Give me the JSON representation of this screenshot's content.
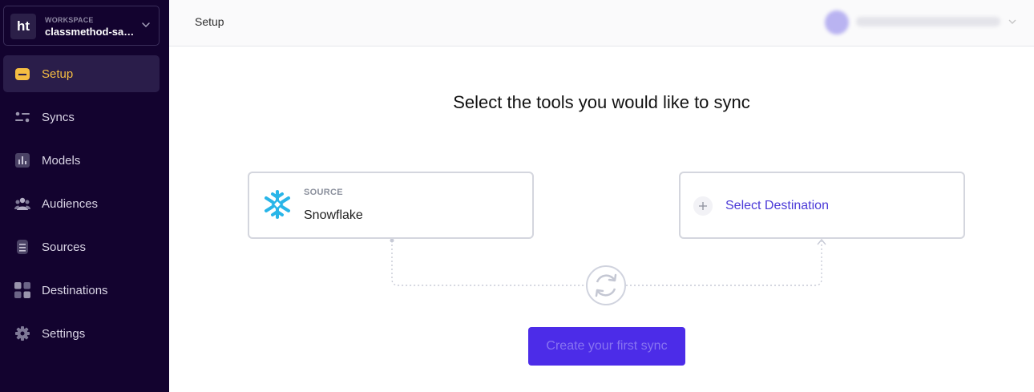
{
  "workspace": {
    "logo_text": "ht",
    "label": "WORKSPACE",
    "name": "classmethod-sag…"
  },
  "sidebar": {
    "items": [
      {
        "label": "Setup",
        "icon": "folder-icon",
        "active": true
      },
      {
        "label": "Syncs",
        "icon": "syncs-icon",
        "active": false
      },
      {
        "label": "Models",
        "icon": "bar-chart-icon",
        "active": false
      },
      {
        "label": "Audiences",
        "icon": "users-icon",
        "active": false
      },
      {
        "label": "Sources",
        "icon": "database-icon",
        "active": false
      },
      {
        "label": "Destinations",
        "icon": "grid-icon",
        "active": false
      },
      {
        "label": "Settings",
        "icon": "gear-icon",
        "active": false
      }
    ]
  },
  "header": {
    "breadcrumb": "Setup"
  },
  "main": {
    "heading": "Select the tools you would like to sync",
    "source": {
      "label": "SOURCE",
      "name": "Snowflake"
    },
    "destination": {
      "label": "Select Destination"
    },
    "cta_label": "Create your first sync"
  },
  "colors": {
    "sidebar_bg": "#13032f",
    "active_accent": "#f5bd42",
    "primary": "#4c2ce8",
    "link": "#4b3ad8",
    "snowflake": "#29b5e8"
  }
}
